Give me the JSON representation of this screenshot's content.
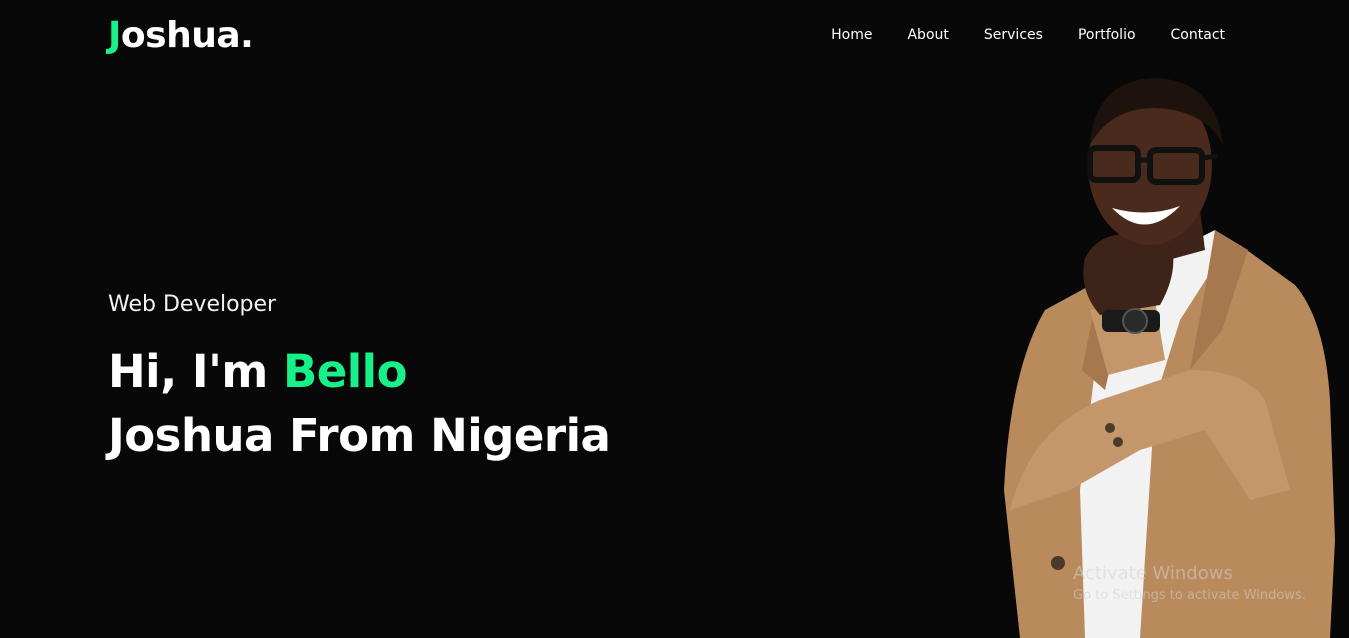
{
  "header": {
    "logo_initial": "J",
    "logo_rest": "oshua."
  },
  "nav": {
    "items": [
      {
        "label": "Home"
      },
      {
        "label": "About"
      },
      {
        "label": "Services"
      },
      {
        "label": "Portfolio"
      },
      {
        "label": "Contact"
      }
    ]
  },
  "hero": {
    "subtitle": "Web Developer",
    "headline_line1_prefix": "Hi, I'm ",
    "headline_line1_accent": "Bello",
    "headline_line2": "Joshua From Nigeria"
  },
  "watermark": {
    "title": "Activate Windows",
    "subtitle": "Go to Settings to activate Windows."
  },
  "colors": {
    "background": "#080809",
    "accent": "#18f08a",
    "text": "#ffffff",
    "jacket": "#b88a5c"
  },
  "icons": {
    "portrait": "portrait-photo"
  }
}
